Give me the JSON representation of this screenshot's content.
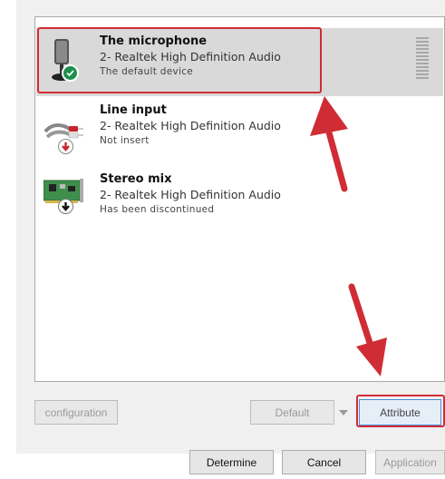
{
  "devices": [
    {
      "name": "The microphone",
      "driver": "2- Realtek High Definition Audio",
      "status": "The default device"
    },
    {
      "name": "Line input",
      "driver": "2- Realtek High Definition Audio",
      "status": "Not insert"
    },
    {
      "name": "Stereo mix",
      "driver": "2- Realtek High Definition Audio",
      "status": "Has been discontinued"
    }
  ],
  "buttons": {
    "configuration": "configuration",
    "default": "Default",
    "attribute": "Attribute",
    "determine": "Determine",
    "cancel": "Cancel",
    "application": "Application"
  },
  "colors": {
    "highlight": "#d02c35",
    "selected_row": "#d9d9d9",
    "status_ok": "#1e8f4e",
    "status_warn": "#c8232c"
  },
  "icons": [
    "microphone-icon",
    "default-check-icon",
    "line-input-cable-icon",
    "down-arrow-red-icon",
    "stereo-mix-card-icon",
    "down-arrow-black-icon",
    "level-meter-icon",
    "chevron-down-icon"
  ]
}
